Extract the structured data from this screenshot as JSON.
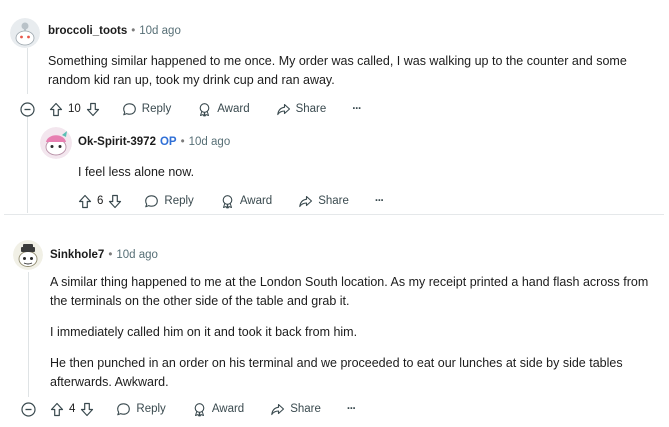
{
  "comments": [
    {
      "author": "broccoli_toots",
      "time": "10d ago",
      "paragraphs": [
        "Something similar happened to me once. My order was called, I was walking up to the counter and some random kid ran up, took my drink cup and ran away."
      ],
      "votes": "10",
      "reply_label": "Reply",
      "award_label": "Award",
      "share_label": "Share",
      "more_label": "···"
    },
    {
      "author": "Ok-Spirit-3972",
      "op_badge": "OP",
      "time": "10d ago",
      "paragraphs": [
        "I feel less alone now."
      ],
      "votes": "6",
      "reply_label": "Reply",
      "award_label": "Award",
      "share_label": "Share",
      "more_label": "···"
    },
    {
      "author": "Sinkhole7",
      "time": "10d ago",
      "paragraphs": [
        "A similar thing happened to me at the London South location. As my receipt printed a hand flash across from the terminals on the other side of the table and grab it.",
        "I immediately called him on it and took it back from him.",
        "He then punched in an order on his terminal and we proceeded to eat our lunches at side by side tables afterwards. Awkward."
      ],
      "votes": "4",
      "reply_label": "Reply",
      "award_label": "Award",
      "share_label": "Share",
      "more_label": "···"
    }
  ],
  "sep": "•",
  "icons": {
    "upvote": "upvote-arrow-icon",
    "downvote": "downvote-arrow-icon",
    "reply": "speech-bubble-icon",
    "award": "award-ribbon-icon",
    "share": "share-arrow-icon",
    "collapse": "collapse-minus-icon"
  },
  "colors": {
    "op_badge": "#2f6fd6",
    "meta_text": "#576f76",
    "thread_line": "#dfe3e5"
  }
}
